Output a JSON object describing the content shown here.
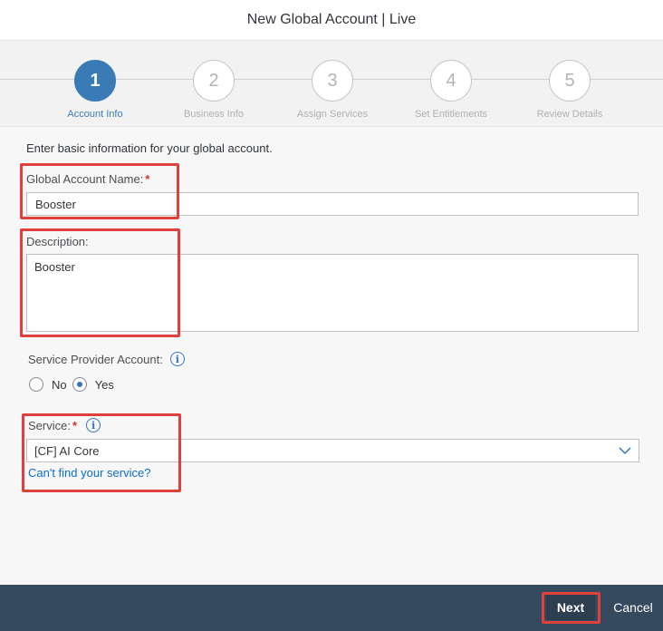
{
  "dialog": {
    "title": "New Global Account | Live"
  },
  "wizard": {
    "steps": [
      {
        "number": "1",
        "label": "Account Info",
        "active": true
      },
      {
        "number": "2",
        "label": "Business Info",
        "active": false
      },
      {
        "number": "3",
        "label": "Assign Services",
        "active": false
      },
      {
        "number": "4",
        "label": "Set Entitlements",
        "active": false
      },
      {
        "number": "5",
        "label": "Review Details",
        "active": false
      }
    ]
  },
  "form": {
    "intro": "Enter basic information for your global account.",
    "account_name": {
      "label": "Global Account Name:",
      "required_mark": "*",
      "value": "Booster"
    },
    "description": {
      "label": "Description:",
      "value": "Booster"
    },
    "service_provider": {
      "label": "Service Provider Account:",
      "option_no": "No",
      "option_yes": "Yes",
      "selected": "Yes"
    },
    "service": {
      "label": "Service:",
      "required_mark": "*",
      "value": "[CF] AI Core",
      "help_link": "Can't find your service?"
    }
  },
  "footer": {
    "next_label": "Next",
    "cancel_label": "Cancel"
  },
  "colors": {
    "accent": "#3b7bb5",
    "highlight": "#e0403c",
    "footer": "#354a5f",
    "link": "#0a6ed1"
  },
  "icons": {
    "info": "info-circle-icon",
    "dropdown": "chevron-down-icon"
  }
}
